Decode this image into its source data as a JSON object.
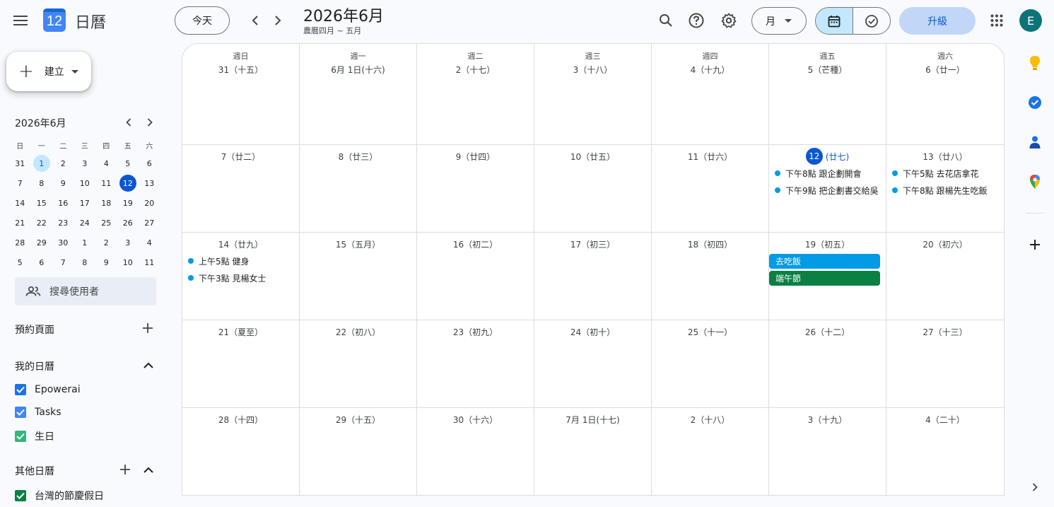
{
  "header": {
    "app_name": "日曆",
    "logo_text": "12",
    "today_label": "今天",
    "title": "2026年6月",
    "subtitle": "農曆四月 ~ 五月",
    "view_label": "月",
    "upgrade_label": "升級",
    "avatar_letter": "E"
  },
  "sidebar": {
    "create_label": "建立",
    "mini_title": "2026年6月",
    "weekday_heads": [
      "日",
      "一",
      "二",
      "三",
      "四",
      "五",
      "六"
    ],
    "mini_weeks": [
      [
        "31",
        "1",
        "2",
        "3",
        "4",
        "5",
        "6"
      ],
      [
        "7",
        "8",
        "9",
        "10",
        "11",
        "12",
        "13"
      ],
      [
        "14",
        "15",
        "16",
        "17",
        "18",
        "19",
        "20"
      ],
      [
        "21",
        "22",
        "23",
        "24",
        "25",
        "26",
        "27"
      ],
      [
        "28",
        "29",
        "30",
        "1",
        "2",
        "3",
        "4"
      ],
      [
        "5",
        "6",
        "7",
        "8",
        "9",
        "10",
        "11"
      ]
    ],
    "user_search_placeholder": "搜尋使用者",
    "booking_pages": "預約頁面",
    "my_calendars": "我的日曆",
    "my_calendar_items": [
      {
        "label": "Epowerai",
        "color": "#1a73e8"
      },
      {
        "label": "Tasks",
        "color": "#4285f4"
      },
      {
        "label": "生日",
        "color": "#33b679"
      }
    ],
    "other_calendars": "其他日曆",
    "other_calendar_items": [
      {
        "label": "台灣的節慶假日",
        "color": "#0b8043"
      }
    ]
  },
  "grid": {
    "weekdays": [
      "週日",
      "週一",
      "週二",
      "週三",
      "週四",
      "週五",
      "週六"
    ],
    "weeks": [
      [
        "31（十五）",
        "6月 1日(十六)",
        "2（十七）",
        "3（十八）",
        "4（十九）",
        "5（芒種）",
        "6（廿一）"
      ],
      [
        "7（廿二）",
        "8（廿三）",
        "9（廿四）",
        "10（廿五）",
        "11（廿六）",
        "",
        "13（廿八）"
      ],
      [
        "14（廿九）",
        "15（五月）",
        "16（初二）",
        "17（初三）",
        "18（初四）",
        "19（初五）",
        "20（初六）"
      ],
      [
        "21（夏至）",
        "22（初八）",
        "23（初九）",
        "24（初十）",
        "25（十一）",
        "26（十二）",
        "27（十三）"
      ],
      [
        "28（十四）",
        "29（十五）",
        "30（十六）",
        "7月 1日(十七)",
        "2（十八）",
        "3（十九）",
        "4（二十）"
      ]
    ],
    "today_number": "12",
    "today_lunar": "(廿七)",
    "events": {
      "fri12_1": "下午8點 跟企劃開會",
      "fri12_2": "下午9點 把企劃書交給吳",
      "sat13_1": "下午5點 去花店拿花",
      "sat13_2": "下午8點 跟楊先生吃飯",
      "sun14_1": "上午5點 健身",
      "sun14_2": "下午3點 見楊女士",
      "fri19_chip1": "去吃飯",
      "fri19_chip2": "端午節"
    },
    "colors": {
      "event_dot": "#039be5",
      "chip_blue": "#039be5",
      "chip_green": "#0b8043",
      "today": "#0b57d0"
    }
  }
}
